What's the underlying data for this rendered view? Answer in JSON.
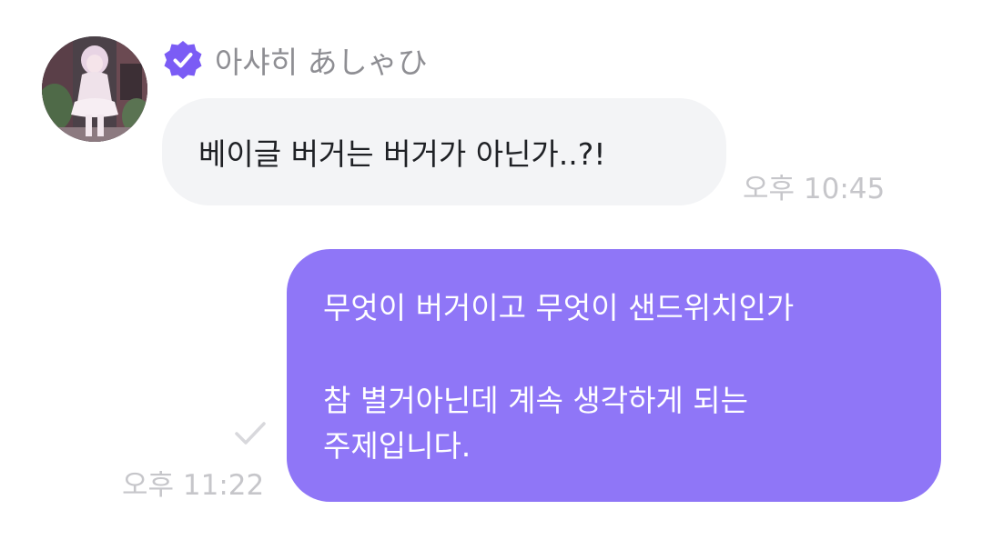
{
  "incoming": {
    "sender_name": "아샤히 あしゃひ",
    "verified_icon": "verified-check-icon",
    "avatar_icon": "profile-photo",
    "message": "베이글 버거는 버거가 아닌가..?!",
    "time": "오후 10:45"
  },
  "outgoing": {
    "lines": [
      "무엇이 버거이고 무엇이 샌드위치인가",
      "",
      "참 별거아닌데 계속 생각하게 되는",
      "주제입니다."
    ],
    "time": "오후 11:22",
    "read_icon": "checkmark-icon"
  },
  "colors": {
    "accent": "#8f76f7",
    "incoming_bubble": "#f3f4f6",
    "verified_badge": "#7b5cf5",
    "timestamp": "#c6c6ca",
    "sender_name": "#8e8e93"
  }
}
